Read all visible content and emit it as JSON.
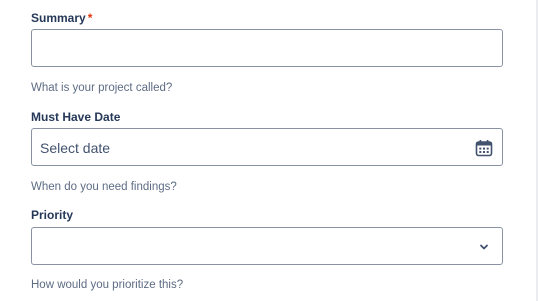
{
  "form": {
    "summary": {
      "label": "Summary",
      "required_mark": "*",
      "value": "",
      "help": "What is your project called?"
    },
    "must_have_date": {
      "label": "Must Have Date",
      "placeholder": "Select date",
      "icon": "calendar-icon",
      "help": "When do you need findings?"
    },
    "priority": {
      "label": "Priority",
      "selected_value": "",
      "icon": "chevron-down-icon",
      "help": "How would you prioritize this?"
    }
  }
}
